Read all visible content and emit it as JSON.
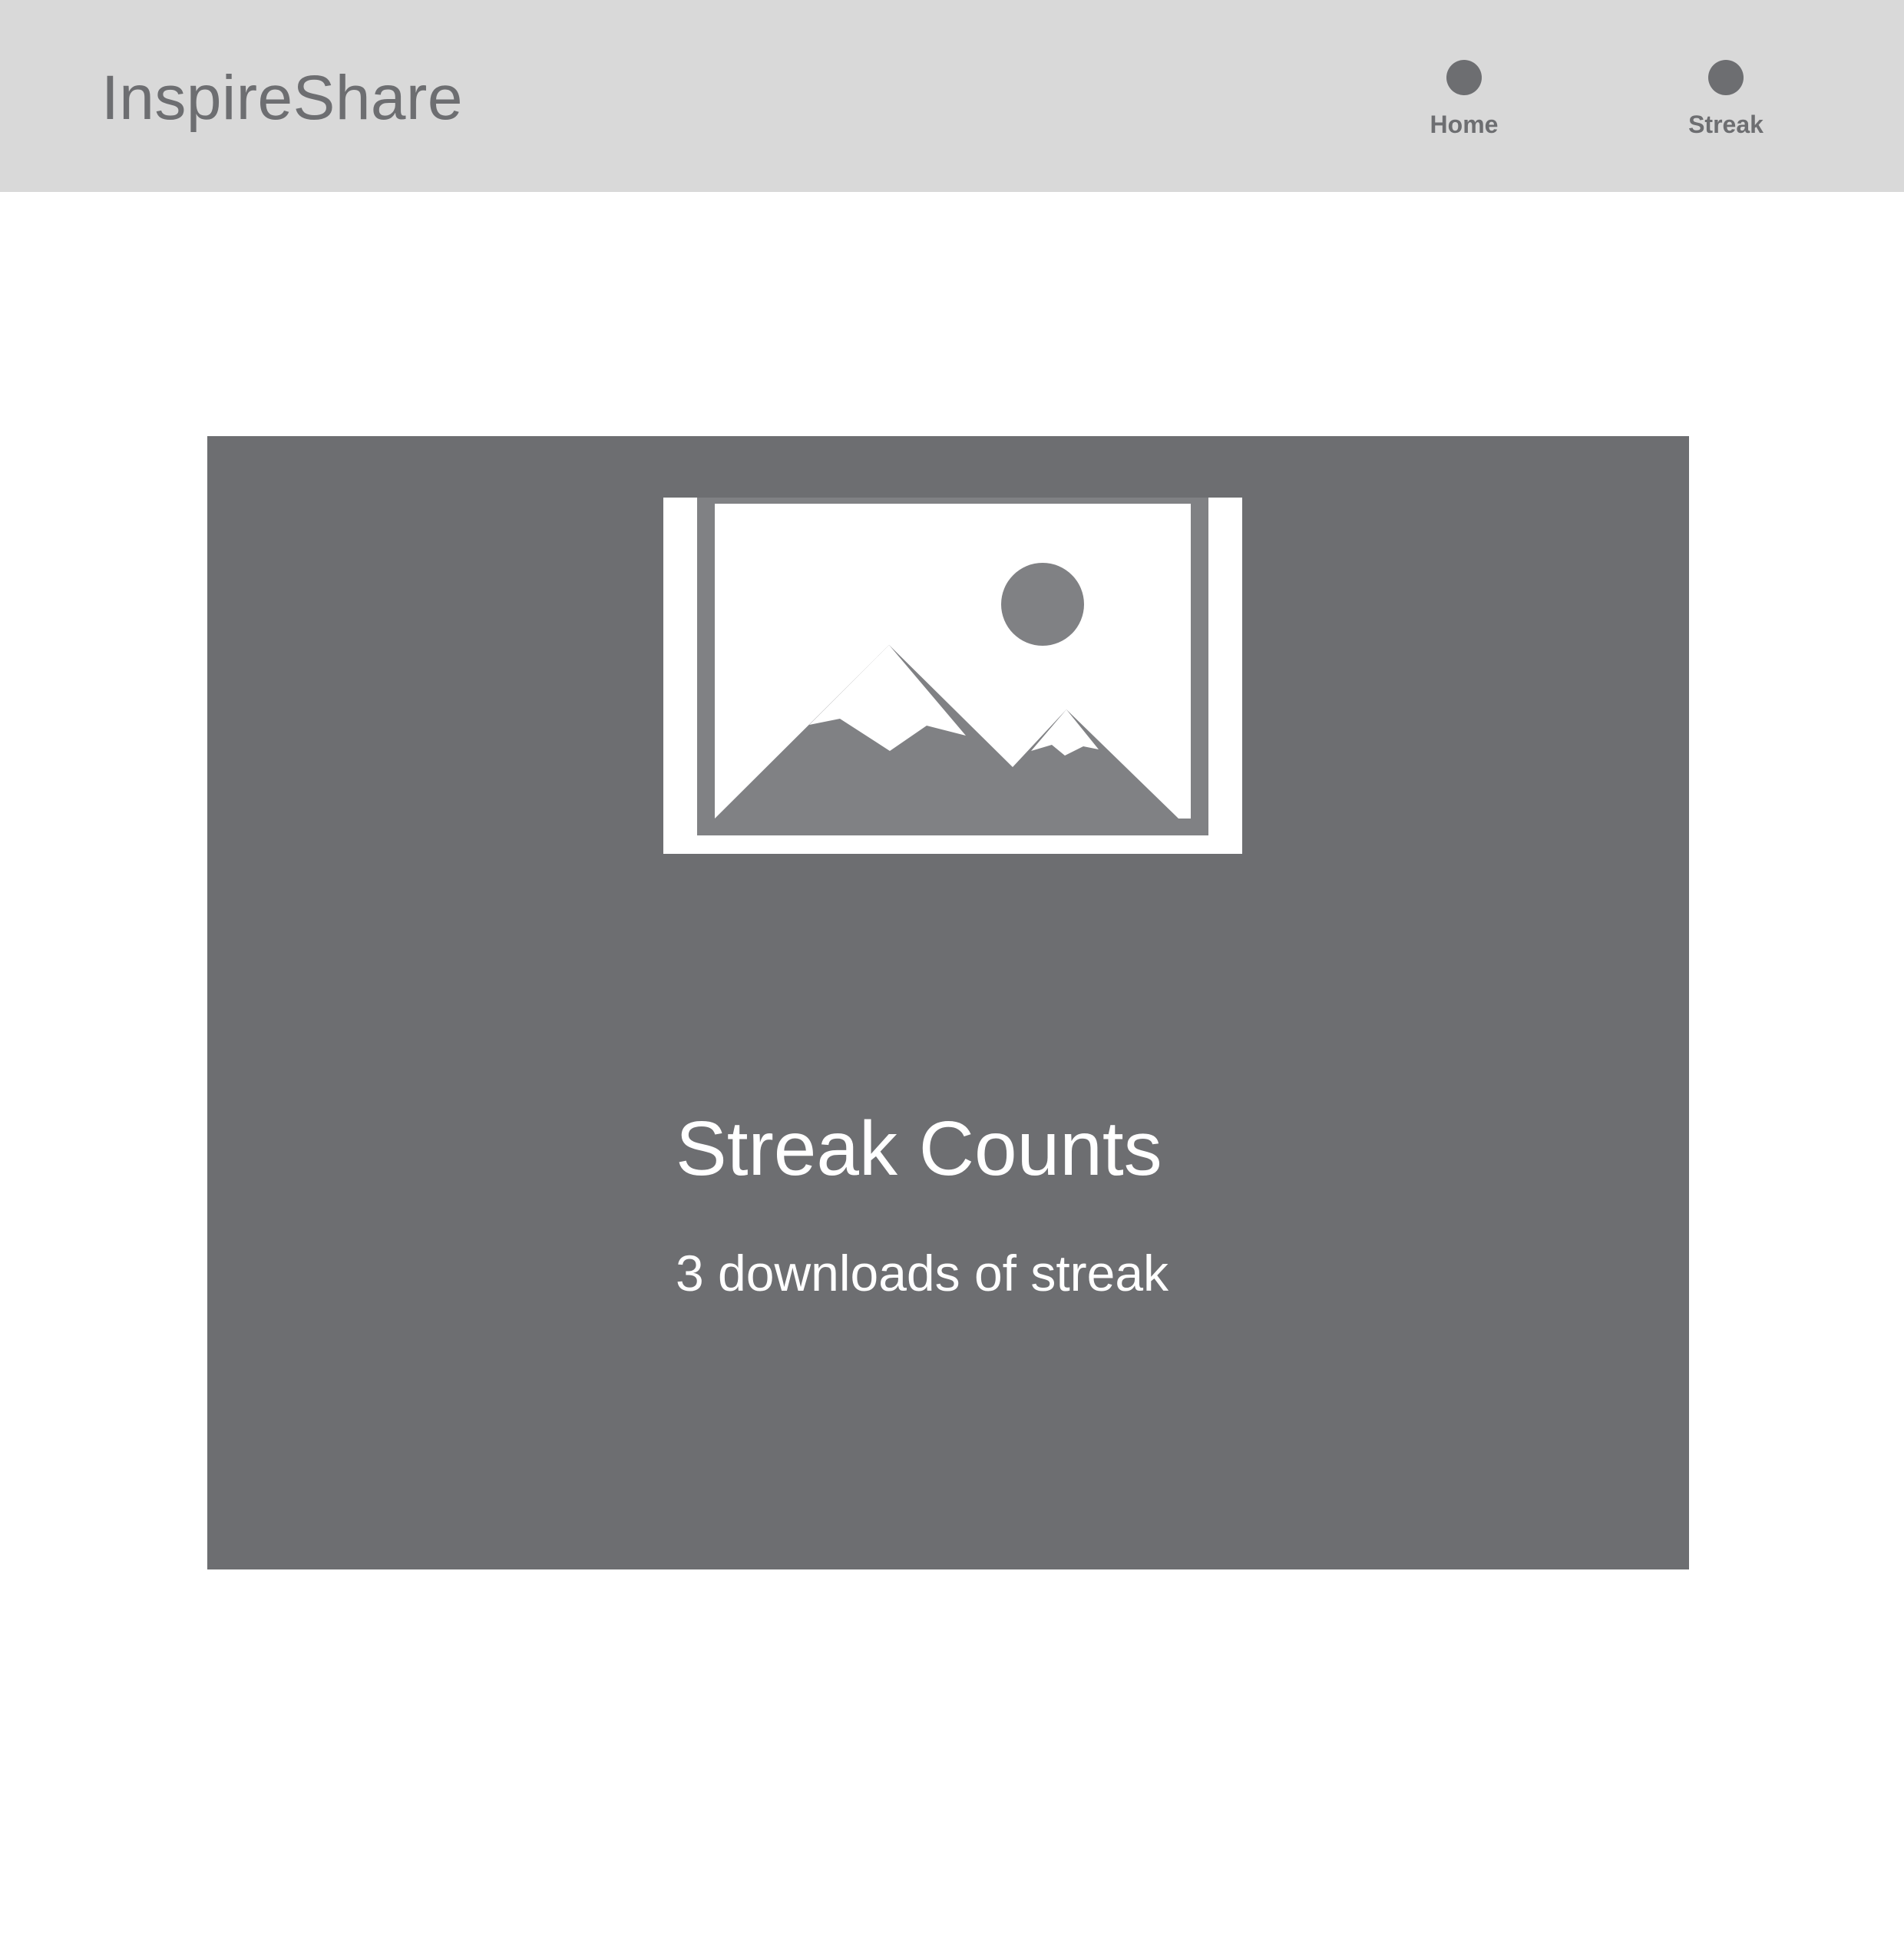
{
  "header": {
    "brand": "InspireShare",
    "nav": [
      {
        "label": "Home",
        "icon": "circle-dot-icon"
      },
      {
        "label": "Streak",
        "icon": "circle-dot-icon"
      }
    ]
  },
  "card": {
    "image_icon": "image-placeholder-icon",
    "title": "Streak Counts",
    "subtitle": "3 downloads of streak"
  },
  "colors": {
    "header_background": "#d9d9d9",
    "card_background": "#6d6e71",
    "text_muted": "#6d6e71",
    "text_on_card": "#ffffff"
  }
}
